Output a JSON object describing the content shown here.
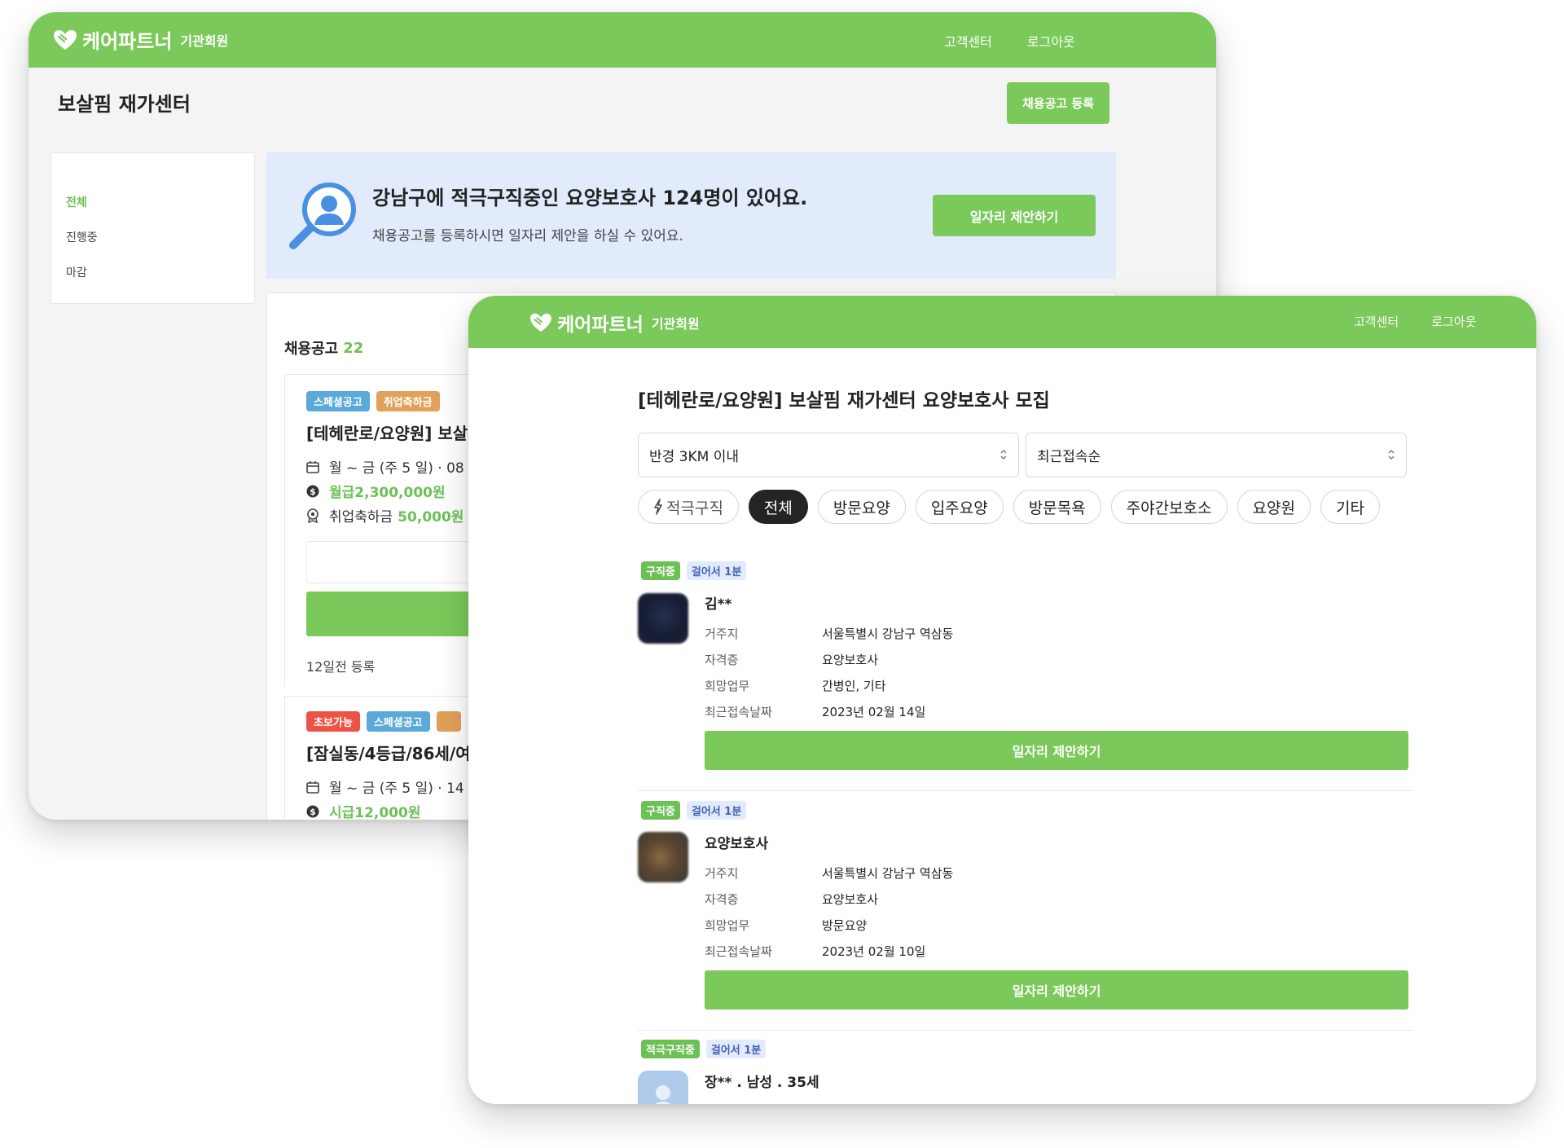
{
  "back": {
    "header": {
      "logo": "케어파트너",
      "logo_sub": "기관회원",
      "nav": [
        "고객센터",
        "로그아웃"
      ]
    },
    "page_title": "보살핌 재가센터",
    "register_button": "채용공고 등록",
    "sidebar": {
      "items": [
        {
          "label": "전체",
          "active": true
        },
        {
          "label": "진행중",
          "active": false
        },
        {
          "label": "마감",
          "active": false
        }
      ]
    },
    "banner": {
      "title": "강남구에 적극구직중인 요양보호사 124명이 있어요.",
      "subtitle": "채용공고를 등록하시면 일자리 제안을 하실 수 있어요.",
      "button": "일자리 제안하기"
    },
    "jobs": {
      "heading": "채용공고",
      "count": "22",
      "items": [
        {
          "tags": [
            {
              "label": "스페셜공고",
              "color": "#5aa9d8"
            },
            {
              "label": "취업축하금",
              "color": "#e2a05a"
            }
          ],
          "title": "[테헤란로/요양원] 보살",
          "schedule": "월 ~ 금 (주 5 일) · 08",
          "pay": "월급2,300,000원",
          "bonus_label": "취업축하금",
          "bonus_value": "50,000원",
          "registered": "12일전 등록"
        },
        {
          "tags": [
            {
              "label": "초보가능",
              "color": "#ec5245"
            },
            {
              "label": "스페셜공고",
              "color": "#5aa9d8"
            },
            {
              "label": "",
              "color": "#e2a05a"
            }
          ],
          "title": "[잠실동/4등급/86세/여",
          "schedule": "월 ~ 금 (주 5 일) · 14",
          "pay": "시급12,000원"
        }
      ]
    }
  },
  "front": {
    "header": {
      "logo": "케어파트너",
      "logo_sub": "기관회원",
      "nav": [
        "고객센터",
        "로그아웃"
      ]
    },
    "title": "[테헤란로/요양원] 보살핌 재가센터 요양보호사 모집",
    "filters": {
      "radius": "반경 3KM 이내",
      "sort": "최근접속순"
    },
    "chips": [
      {
        "label": "적극구직",
        "icon": "lightning-icon",
        "active": false
      },
      {
        "label": "전체",
        "active": true
      },
      {
        "label": "방문요양",
        "active": false
      },
      {
        "label": "입주요양",
        "active": false
      },
      {
        "label": "방문목욕",
        "active": false
      },
      {
        "label": "주야간보호소",
        "active": false
      },
      {
        "label": "요양원",
        "active": false
      },
      {
        "label": "기타",
        "active": false
      }
    ],
    "labels": {
      "residence": "거주지",
      "certificate": "자격증",
      "desired_work": "희망업무",
      "last_login": "최근접속날짜"
    },
    "candidates": [
      {
        "status": "구직중",
        "distance": "걸어서 1분",
        "name": "김**",
        "residence": "서울특별시 강남구 역삼동",
        "certificate": "요양보호사",
        "desired_work": "간병인, 기타",
        "last_login": "2023년 02월 14일",
        "button": "일자리 제안하기"
      },
      {
        "status": "구직중",
        "distance": "걸어서 1분",
        "name": "요양보호사",
        "residence": "서울특별시 강남구 역삼동",
        "certificate": "요양보호사",
        "desired_work": "방문요양",
        "last_login": "2023년 02월 10일",
        "button": "일자리 제안하기"
      },
      {
        "status": "적극구직중",
        "distance": "걸어서 1분",
        "name": "장** . 남성 . 35세"
      }
    ],
    "colors": {
      "brand_green": "#7ac95a",
      "chip_active": "#242424",
      "tag_light": "#e1ebfb"
    }
  }
}
